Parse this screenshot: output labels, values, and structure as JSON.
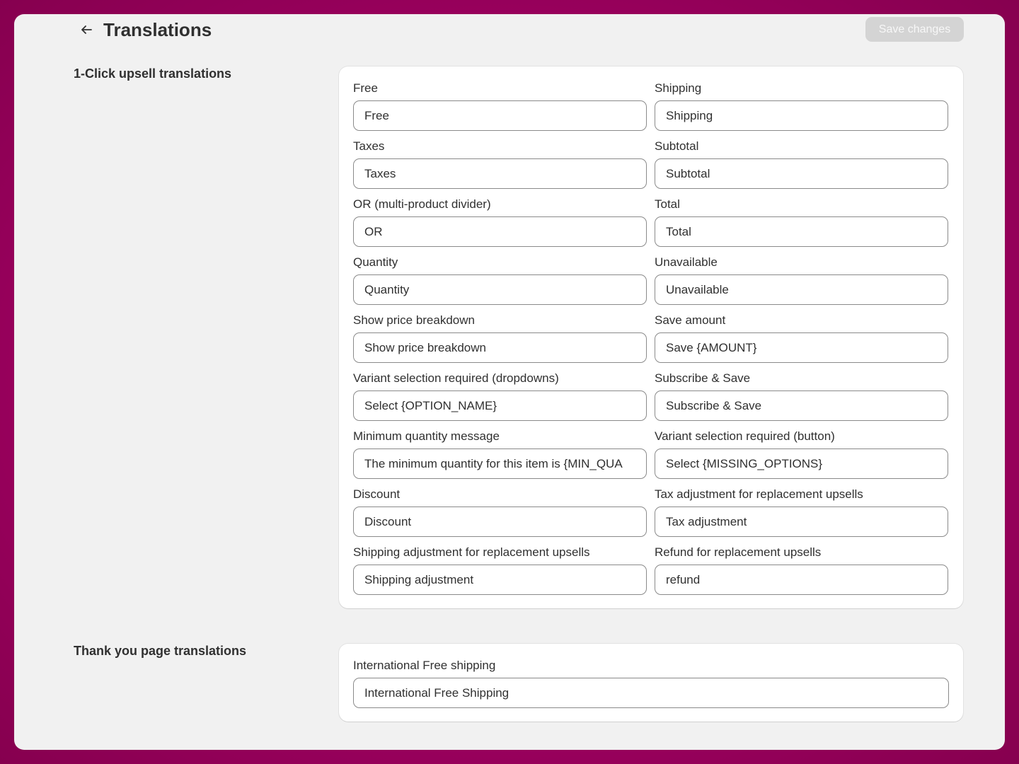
{
  "header": {
    "title": "Translations",
    "save_label": "Save changes"
  },
  "sections": {
    "upsell": {
      "title": "1-Click upsell translations",
      "fields": [
        {
          "label": "Free",
          "value": "Free"
        },
        {
          "label": "Shipping",
          "value": "Shipping"
        },
        {
          "label": "Taxes",
          "value": "Taxes"
        },
        {
          "label": "Subtotal",
          "value": "Subtotal"
        },
        {
          "label": "OR (multi-product divider)",
          "value": "OR"
        },
        {
          "label": "Total",
          "value": "Total"
        },
        {
          "label": "Quantity",
          "value": "Quantity"
        },
        {
          "label": "Unavailable",
          "value": "Unavailable"
        },
        {
          "label": "Show price breakdown",
          "value": "Show price breakdown"
        },
        {
          "label": "Save amount",
          "value": "Save {AMOUNT}"
        },
        {
          "label": "Variant selection required (dropdowns)",
          "value": "Select {OPTION_NAME}"
        },
        {
          "label": "Subscribe & Save",
          "value": "Subscribe & Save"
        },
        {
          "label": "Minimum quantity message",
          "value": "The minimum quantity for this item is {MIN_QUA"
        },
        {
          "label": "Variant selection required (button)",
          "value": "Select {MISSING_OPTIONS}"
        },
        {
          "label": "Discount",
          "value": "Discount"
        },
        {
          "label": "Tax adjustment for replacement upsells",
          "value": "Tax adjustment"
        },
        {
          "label": "Shipping adjustment for replacement upsells",
          "value": "Shipping adjustment"
        },
        {
          "label": "Refund for replacement upsells",
          "value": "refund"
        }
      ]
    },
    "thank_you": {
      "title": "Thank you page translations",
      "fields": [
        {
          "label": "International Free shipping",
          "value": "International Free Shipping"
        }
      ]
    }
  }
}
